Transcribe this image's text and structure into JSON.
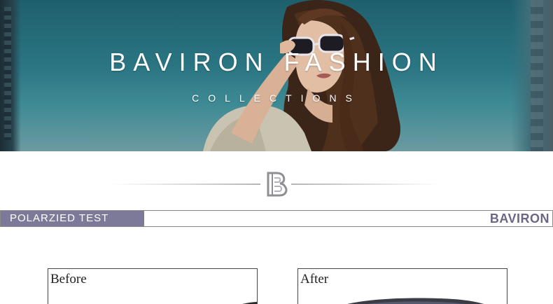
{
  "hero": {
    "title": "BAVIRON FASHION",
    "subtitle": "COLLECTIONS",
    "image": "woman-wearing-sunglasses-photo"
  },
  "divider": {
    "logo_icon": "baviron-b-logo-icon"
  },
  "section": {
    "tab_label": "POLARZIED TEST",
    "brand": "BAVIRON"
  },
  "compare": {
    "before_label": "Before",
    "after_label": "After"
  },
  "colors": {
    "tab_bg": "#7d7a99",
    "brand_text": "#6a6787",
    "hero_sky": "#2b7683"
  }
}
